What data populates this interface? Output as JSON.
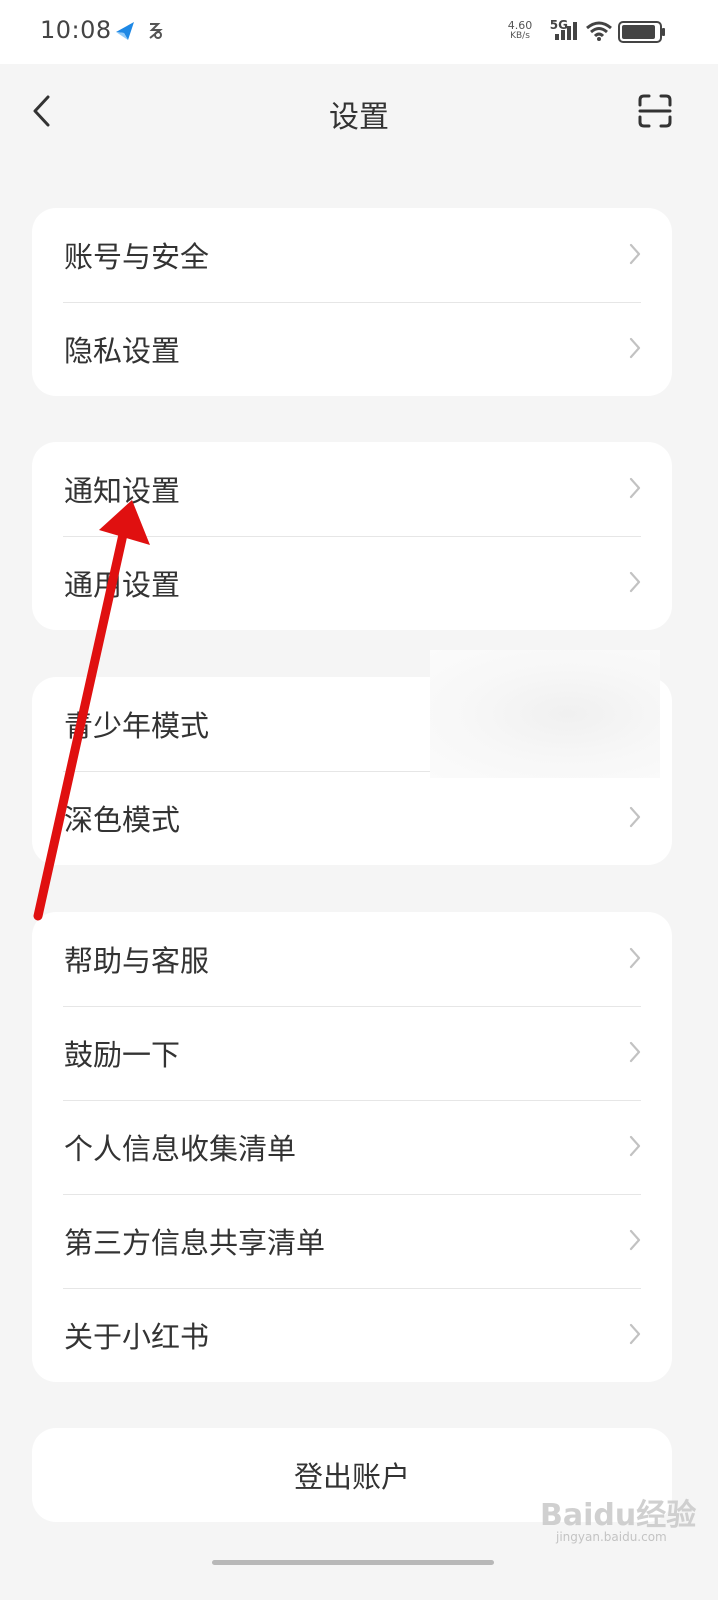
{
  "status_bar": {
    "time": "10:08",
    "net_speed": "4.60",
    "net_unit": "KB/s",
    "network": "5G",
    "icons": [
      "app-notification-icon",
      "chat-app-icon",
      "signal-icon",
      "wifi-icon",
      "battery-icon"
    ]
  },
  "header": {
    "title": "设置",
    "back_icon": "chevron-left-icon",
    "scan_icon": "scan-icon"
  },
  "groups": [
    {
      "items": [
        {
          "label": "账号与安全"
        },
        {
          "label": "隐私设置"
        }
      ]
    },
    {
      "items": [
        {
          "label": "通知设置"
        },
        {
          "label": "通用设置"
        }
      ]
    },
    {
      "items": [
        {
          "label": "青少年模式"
        },
        {
          "label": "深色模式"
        }
      ]
    },
    {
      "items": [
        {
          "label": "帮助与客服"
        },
        {
          "label": "鼓励一下"
        },
        {
          "label": "个人信息收集清单"
        },
        {
          "label": "第三方信息共享清单"
        },
        {
          "label": "关于小红书"
        }
      ]
    }
  ],
  "logout": {
    "label": "登出账户"
  },
  "watermark": {
    "text": "Baidu经验",
    "sub": "jingyan.baidu.com"
  },
  "colors": {
    "background": "#f5f5f5",
    "card": "#ffffff",
    "text": "#333333",
    "annotation": "#e01010"
  }
}
